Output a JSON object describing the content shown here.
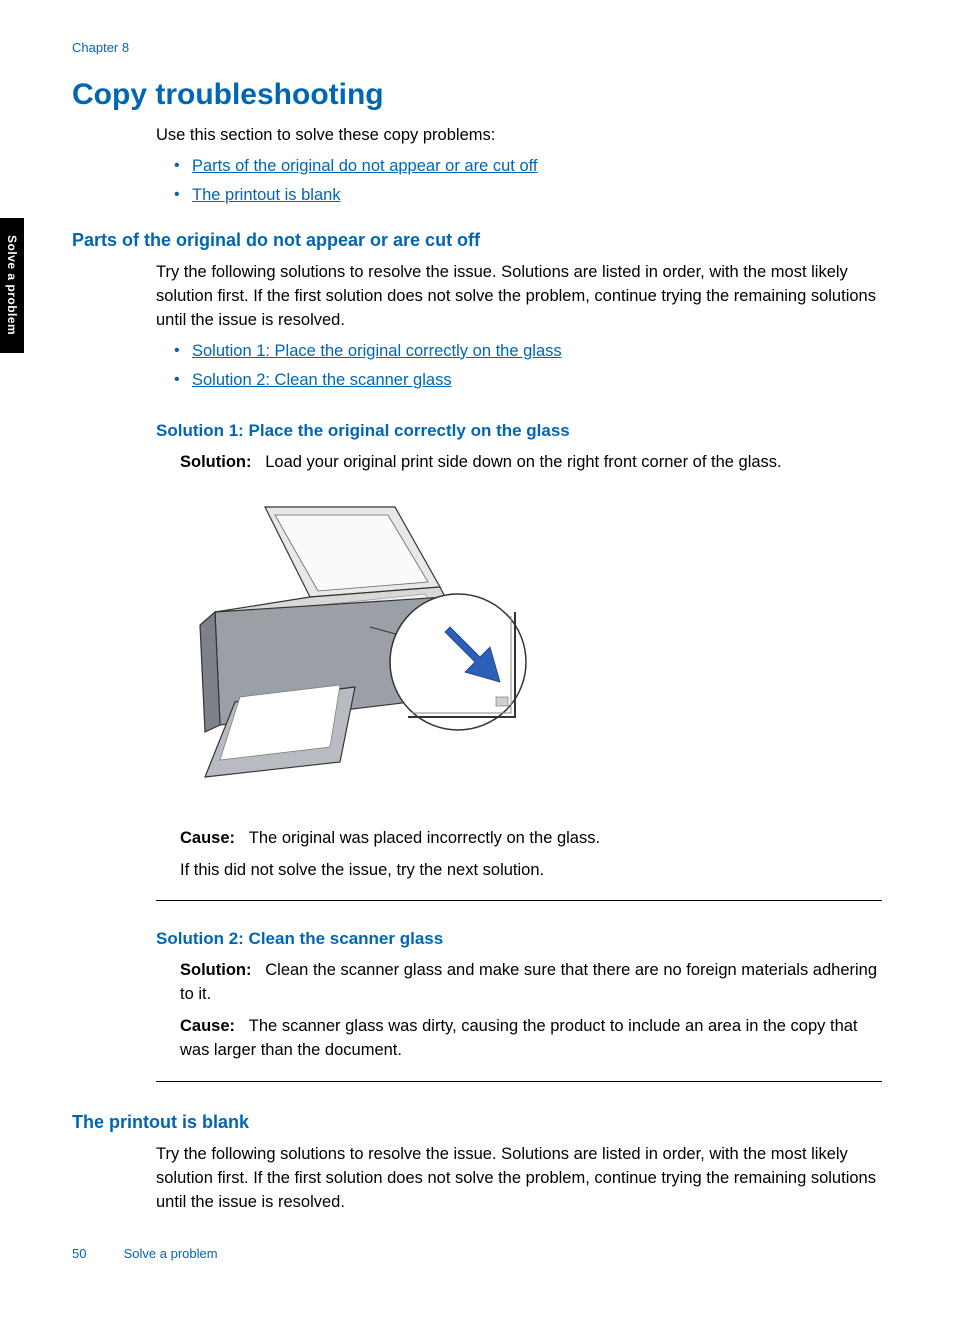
{
  "chapter": "Chapter 8",
  "side_tab": "Solve a problem",
  "page_title": "Copy troubleshooting",
  "intro": "Use this section to solve these copy problems:",
  "toc_links": [
    "Parts of the original do not appear or are cut off",
    "The printout is blank"
  ],
  "section1": {
    "heading": "Parts of the original do not appear or are cut off",
    "intro": "Try the following solutions to resolve the issue. Solutions are listed in order, with the most likely solution first. If the first solution does not solve the problem, continue trying the remaining solutions until the issue is resolved.",
    "links": [
      "Solution 1: Place the original correctly on the glass",
      "Solution 2: Clean the scanner glass"
    ],
    "sol1": {
      "heading": "Solution 1: Place the original correctly on the glass",
      "solution_label": "Solution:",
      "solution_text": "Load your original print side down on the right front corner of the glass.",
      "cause_label": "Cause:",
      "cause_text": "The original was placed incorrectly on the glass.",
      "followup": "If this did not solve the issue, try the next solution."
    },
    "sol2": {
      "heading": "Solution 2: Clean the scanner glass",
      "solution_label": "Solution:",
      "solution_text": "Clean the scanner glass and make sure that there are no foreign materials adhering to it.",
      "cause_label": "Cause:",
      "cause_text": "The scanner glass was dirty, causing the product to include an area in the copy that was larger than the document."
    }
  },
  "section2": {
    "heading": "The printout is blank",
    "intro": "Try the following solutions to resolve the issue. Solutions are listed in order, with the most likely solution first. If the first solution does not solve the problem, continue trying the remaining solutions until the issue is resolved."
  },
  "footer": {
    "page_number": "50",
    "section": "Solve a problem"
  }
}
